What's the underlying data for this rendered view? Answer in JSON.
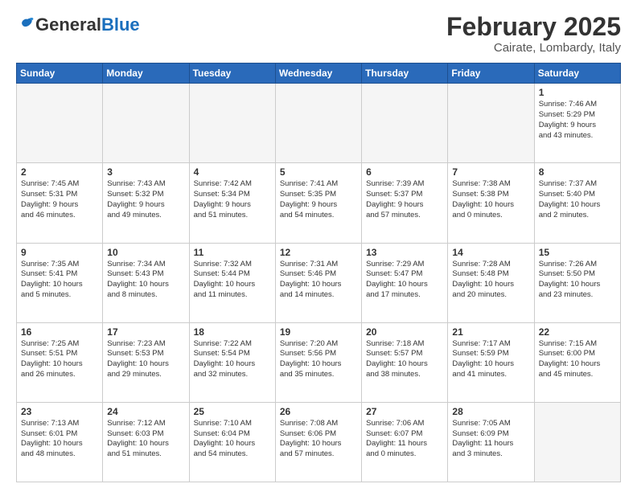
{
  "header": {
    "logo": {
      "general": "General",
      "blue": "Blue"
    },
    "title": "February 2025",
    "location": "Cairate, Lombardy, Italy"
  },
  "weekdays": [
    "Sunday",
    "Monday",
    "Tuesday",
    "Wednesday",
    "Thursday",
    "Friday",
    "Saturday"
  ],
  "weeks": [
    [
      {
        "day": "",
        "info": ""
      },
      {
        "day": "",
        "info": ""
      },
      {
        "day": "",
        "info": ""
      },
      {
        "day": "",
        "info": ""
      },
      {
        "day": "",
        "info": ""
      },
      {
        "day": "",
        "info": ""
      },
      {
        "day": "1",
        "info": "Sunrise: 7:46 AM\nSunset: 5:29 PM\nDaylight: 9 hours\nand 43 minutes."
      }
    ],
    [
      {
        "day": "2",
        "info": "Sunrise: 7:45 AM\nSunset: 5:31 PM\nDaylight: 9 hours\nand 46 minutes."
      },
      {
        "day": "3",
        "info": "Sunrise: 7:43 AM\nSunset: 5:32 PM\nDaylight: 9 hours\nand 49 minutes."
      },
      {
        "day": "4",
        "info": "Sunrise: 7:42 AM\nSunset: 5:34 PM\nDaylight: 9 hours\nand 51 minutes."
      },
      {
        "day": "5",
        "info": "Sunrise: 7:41 AM\nSunset: 5:35 PM\nDaylight: 9 hours\nand 54 minutes."
      },
      {
        "day": "6",
        "info": "Sunrise: 7:39 AM\nSunset: 5:37 PM\nDaylight: 9 hours\nand 57 minutes."
      },
      {
        "day": "7",
        "info": "Sunrise: 7:38 AM\nSunset: 5:38 PM\nDaylight: 10 hours\nand 0 minutes."
      },
      {
        "day": "8",
        "info": "Sunrise: 7:37 AM\nSunset: 5:40 PM\nDaylight: 10 hours\nand 2 minutes."
      }
    ],
    [
      {
        "day": "9",
        "info": "Sunrise: 7:35 AM\nSunset: 5:41 PM\nDaylight: 10 hours\nand 5 minutes."
      },
      {
        "day": "10",
        "info": "Sunrise: 7:34 AM\nSunset: 5:43 PM\nDaylight: 10 hours\nand 8 minutes."
      },
      {
        "day": "11",
        "info": "Sunrise: 7:32 AM\nSunset: 5:44 PM\nDaylight: 10 hours\nand 11 minutes."
      },
      {
        "day": "12",
        "info": "Sunrise: 7:31 AM\nSunset: 5:46 PM\nDaylight: 10 hours\nand 14 minutes."
      },
      {
        "day": "13",
        "info": "Sunrise: 7:29 AM\nSunset: 5:47 PM\nDaylight: 10 hours\nand 17 minutes."
      },
      {
        "day": "14",
        "info": "Sunrise: 7:28 AM\nSunset: 5:48 PM\nDaylight: 10 hours\nand 20 minutes."
      },
      {
        "day": "15",
        "info": "Sunrise: 7:26 AM\nSunset: 5:50 PM\nDaylight: 10 hours\nand 23 minutes."
      }
    ],
    [
      {
        "day": "16",
        "info": "Sunrise: 7:25 AM\nSunset: 5:51 PM\nDaylight: 10 hours\nand 26 minutes."
      },
      {
        "day": "17",
        "info": "Sunrise: 7:23 AM\nSunset: 5:53 PM\nDaylight: 10 hours\nand 29 minutes."
      },
      {
        "day": "18",
        "info": "Sunrise: 7:22 AM\nSunset: 5:54 PM\nDaylight: 10 hours\nand 32 minutes."
      },
      {
        "day": "19",
        "info": "Sunrise: 7:20 AM\nSunset: 5:56 PM\nDaylight: 10 hours\nand 35 minutes."
      },
      {
        "day": "20",
        "info": "Sunrise: 7:18 AM\nSunset: 5:57 PM\nDaylight: 10 hours\nand 38 minutes."
      },
      {
        "day": "21",
        "info": "Sunrise: 7:17 AM\nSunset: 5:59 PM\nDaylight: 10 hours\nand 41 minutes."
      },
      {
        "day": "22",
        "info": "Sunrise: 7:15 AM\nSunset: 6:00 PM\nDaylight: 10 hours\nand 45 minutes."
      }
    ],
    [
      {
        "day": "23",
        "info": "Sunrise: 7:13 AM\nSunset: 6:01 PM\nDaylight: 10 hours\nand 48 minutes."
      },
      {
        "day": "24",
        "info": "Sunrise: 7:12 AM\nSunset: 6:03 PM\nDaylight: 10 hours\nand 51 minutes."
      },
      {
        "day": "25",
        "info": "Sunrise: 7:10 AM\nSunset: 6:04 PM\nDaylight: 10 hours\nand 54 minutes."
      },
      {
        "day": "26",
        "info": "Sunrise: 7:08 AM\nSunset: 6:06 PM\nDaylight: 10 hours\nand 57 minutes."
      },
      {
        "day": "27",
        "info": "Sunrise: 7:06 AM\nSunset: 6:07 PM\nDaylight: 11 hours\nand 0 minutes."
      },
      {
        "day": "28",
        "info": "Sunrise: 7:05 AM\nSunset: 6:09 PM\nDaylight: 11 hours\nand 3 minutes."
      },
      {
        "day": "",
        "info": ""
      }
    ]
  ]
}
